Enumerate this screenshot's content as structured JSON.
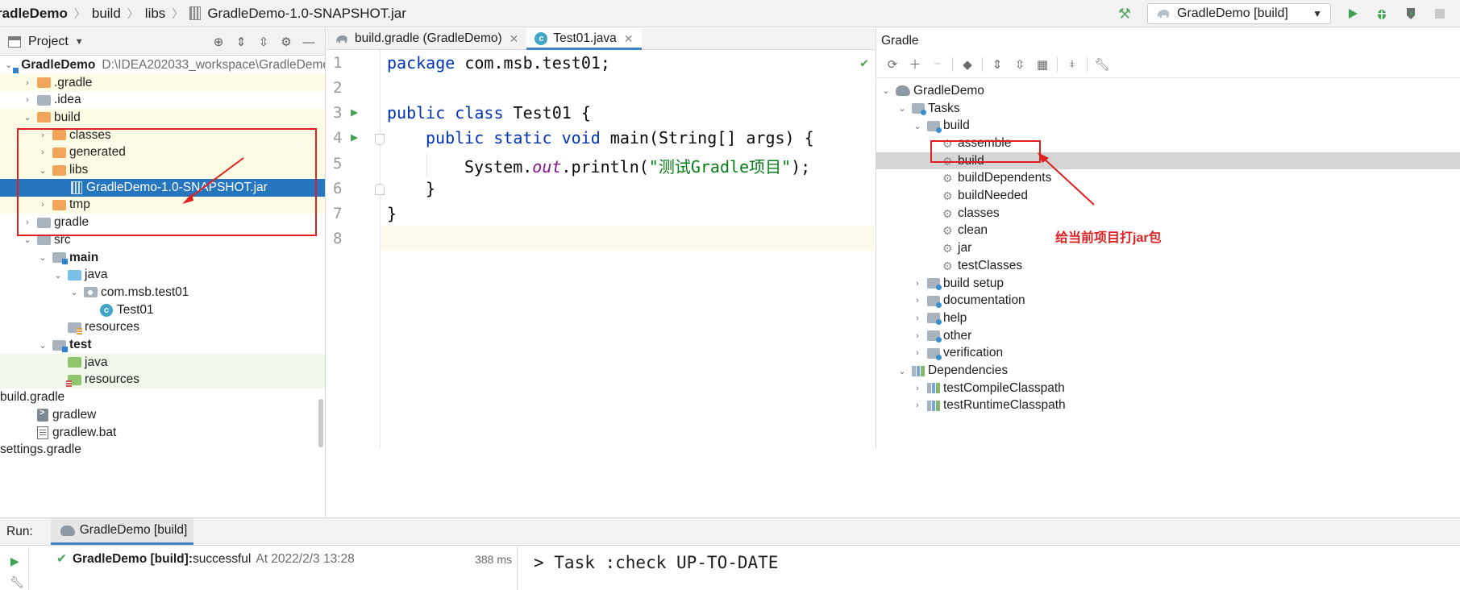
{
  "navbar": {
    "crumbs": [
      "radleDemo",
      "build",
      "libs",
      "GradleDemo-1.0-SNAPSHOT.jar"
    ],
    "run_config": "GradleDemo [build]"
  },
  "project_panel": {
    "title": "Project",
    "rows": [
      {
        "label": "GradleDemo",
        "path": "D:\\IDEA202033_workspace\\GradleDemo"
      },
      {
        "label": ".gradle"
      },
      {
        "label": ".idea"
      },
      {
        "label": "build"
      },
      {
        "label": "classes"
      },
      {
        "label": "generated"
      },
      {
        "label": "libs"
      },
      {
        "label": "GradleDemo-1.0-SNAPSHOT.jar"
      },
      {
        "label": "tmp"
      },
      {
        "label": "gradle"
      },
      {
        "label": "src"
      },
      {
        "label": "main"
      },
      {
        "label": "java"
      },
      {
        "label": "com.msb.test01"
      },
      {
        "label": "Test01"
      },
      {
        "label": "resources"
      },
      {
        "label": "test"
      },
      {
        "label": "java"
      },
      {
        "label": "resources"
      },
      {
        "label": "build.gradle"
      },
      {
        "label": "gradlew"
      },
      {
        "label": "gradlew.bat"
      },
      {
        "label": "settings.gradle"
      }
    ]
  },
  "editor": {
    "tabs": [
      {
        "label": "build.gradle (GradleDemo)"
      },
      {
        "label": "Test01.java"
      }
    ],
    "line_numbers": [
      "1",
      "2",
      "3",
      "4",
      "5",
      "6",
      "7",
      "8"
    ],
    "code": {
      "l1_kw": "package",
      "l1_rest": " com.msb.test01;",
      "l3_kw": "public class",
      "l3_rest": " Test01 {",
      "l4_kw": "public static void",
      "l4_rest": " main(String[] args) {",
      "l5_a": "System.",
      "l5_b": "out",
      "l5_c": ".println(",
      "l5_str": "\"测试Gradle项目\"",
      "l5_d": ");",
      "l6": "}",
      "l7": "}"
    }
  },
  "gradle_panel": {
    "title": "Gradle",
    "rows": [
      {
        "label": "GradleDemo"
      },
      {
        "label": "Tasks"
      },
      {
        "label": "build"
      },
      {
        "label": "assemble"
      },
      {
        "label": "build"
      },
      {
        "label": "buildDependents"
      },
      {
        "label": "buildNeeded"
      },
      {
        "label": "classes"
      },
      {
        "label": "clean"
      },
      {
        "label": "jar"
      },
      {
        "label": "testClasses"
      },
      {
        "label": "build setup"
      },
      {
        "label": "documentation"
      },
      {
        "label": "help"
      },
      {
        "label": "other"
      },
      {
        "label": "verification"
      },
      {
        "label": "Dependencies"
      },
      {
        "label": "testCompileClasspath"
      },
      {
        "label": "testRuntimeClasspath"
      }
    ],
    "annotation": "给当前项目打jar包"
  },
  "run_panel": {
    "label": "Run:",
    "tab": "GradleDemo [build]",
    "result_name": "GradleDemo [build]:",
    "result_status": " successful",
    "result_time": "At 2022/2/3 13:28",
    "duration": "388 ms",
    "console_line": "> Task :check UP-TO-DATE"
  },
  "colors": {
    "selection": "#2675bf",
    "annotation_red": "#e02020",
    "keyword": "#0033b3",
    "string": "#067d17",
    "run_green": "#3fa154"
  }
}
